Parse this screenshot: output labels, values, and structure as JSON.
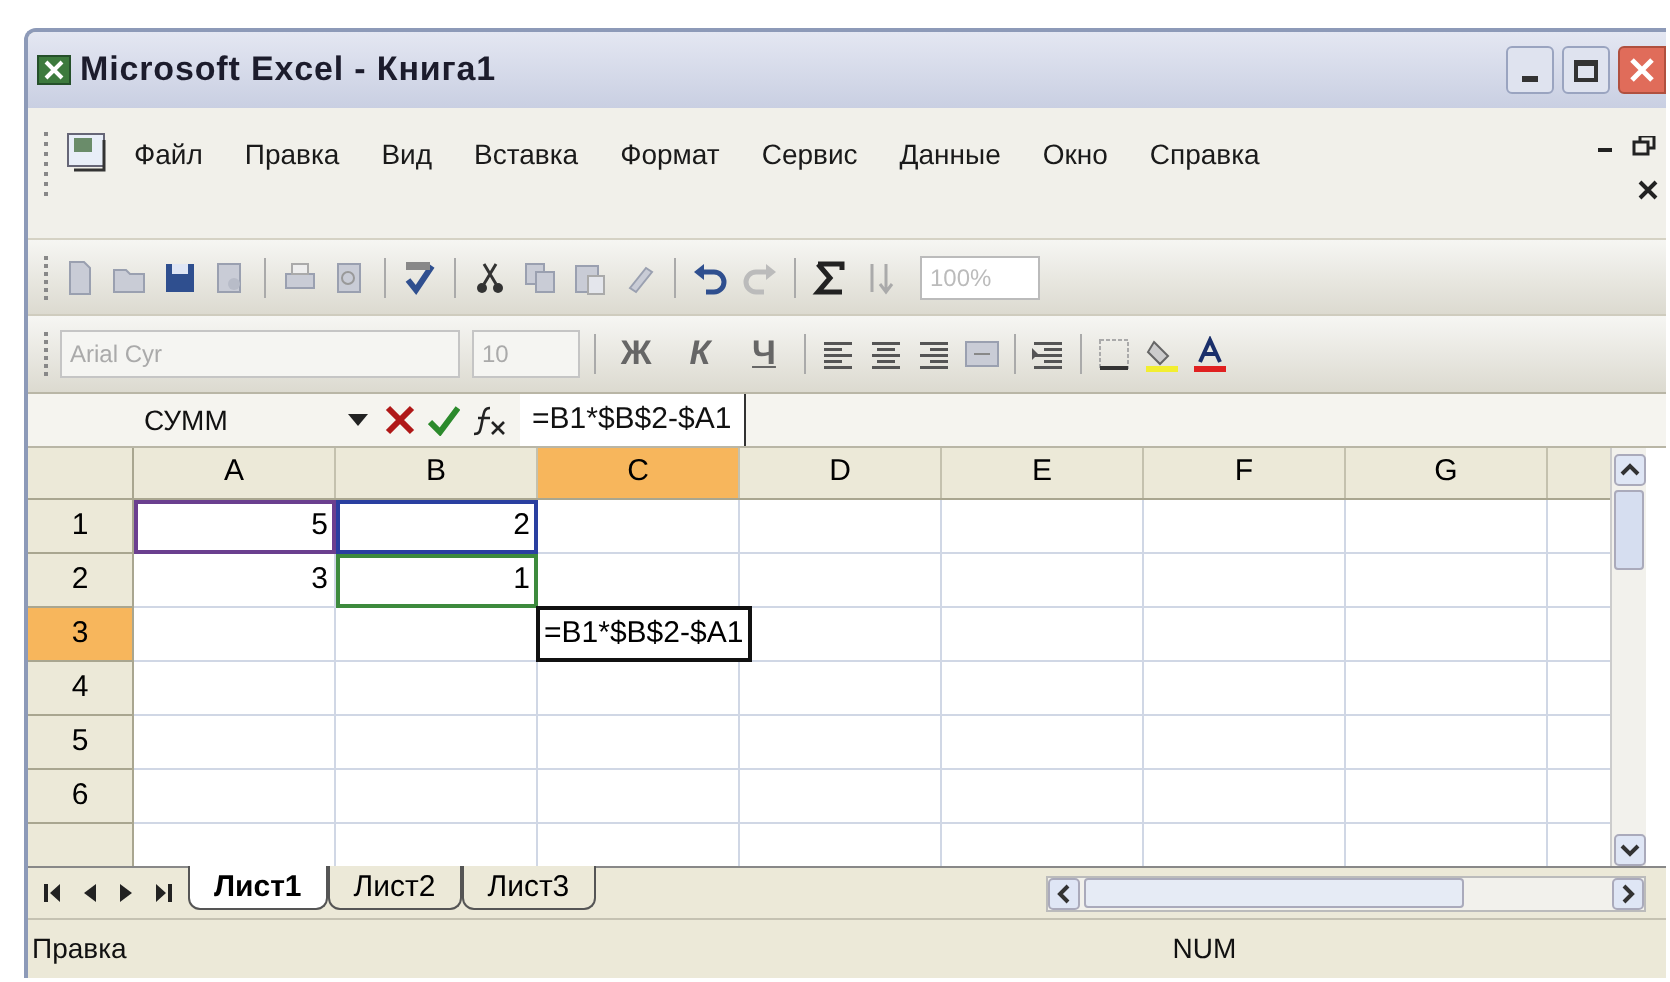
{
  "window": {
    "title": "Microsoft Excel - Книга1"
  },
  "menu": [
    "Файл",
    "Правка",
    "Вид",
    "Вставка",
    "Формат",
    "Сервис",
    "Данные",
    "Окно",
    "Справка"
  ],
  "formatting_toolbar": {
    "font": "Arial Cyr",
    "size": "10",
    "bold": "Ж",
    "italic": "К",
    "underline": "Ч"
  },
  "standard_toolbar": {
    "zoom": "100%"
  },
  "formula_bar": {
    "name_box": "СУММ",
    "formula": "=B1*$B$2-$A1"
  },
  "columns": [
    {
      "label": "A",
      "selected": false
    },
    {
      "label": "B",
      "selected": false
    },
    {
      "label": "C",
      "selected": true
    },
    {
      "label": "D",
      "selected": false
    },
    {
      "label": "E",
      "selected": false
    },
    {
      "label": "F",
      "selected": false
    },
    {
      "label": "G",
      "selected": false
    }
  ],
  "rows": [
    {
      "label": "1",
      "selected": false,
      "cells": [
        {
          "value": "5",
          "color": "#6b3f8f"
        },
        {
          "value": "2",
          "color": "#2a3fa0"
        }
      ]
    },
    {
      "label": "2",
      "selected": false,
      "cells": [
        {
          "value": "3"
        },
        {
          "value": "1",
          "color": "#3d8a3d"
        }
      ]
    },
    {
      "label": "3",
      "selected": true,
      "cells": [
        null,
        null,
        {
          "value": "=B1*$B$2-$A1",
          "kind": "editing"
        }
      ]
    },
    {
      "label": "4",
      "selected": false
    },
    {
      "label": "5",
      "selected": false
    },
    {
      "label": "6",
      "selected": false
    }
  ],
  "sheet_tabs": [
    {
      "label": "Лист1",
      "selected": true
    },
    {
      "label": "Лист2",
      "selected": false
    },
    {
      "label": "Лист3",
      "selected": false
    }
  ],
  "status_bar": {
    "mode": "Правка",
    "indicator": "NUM"
  }
}
